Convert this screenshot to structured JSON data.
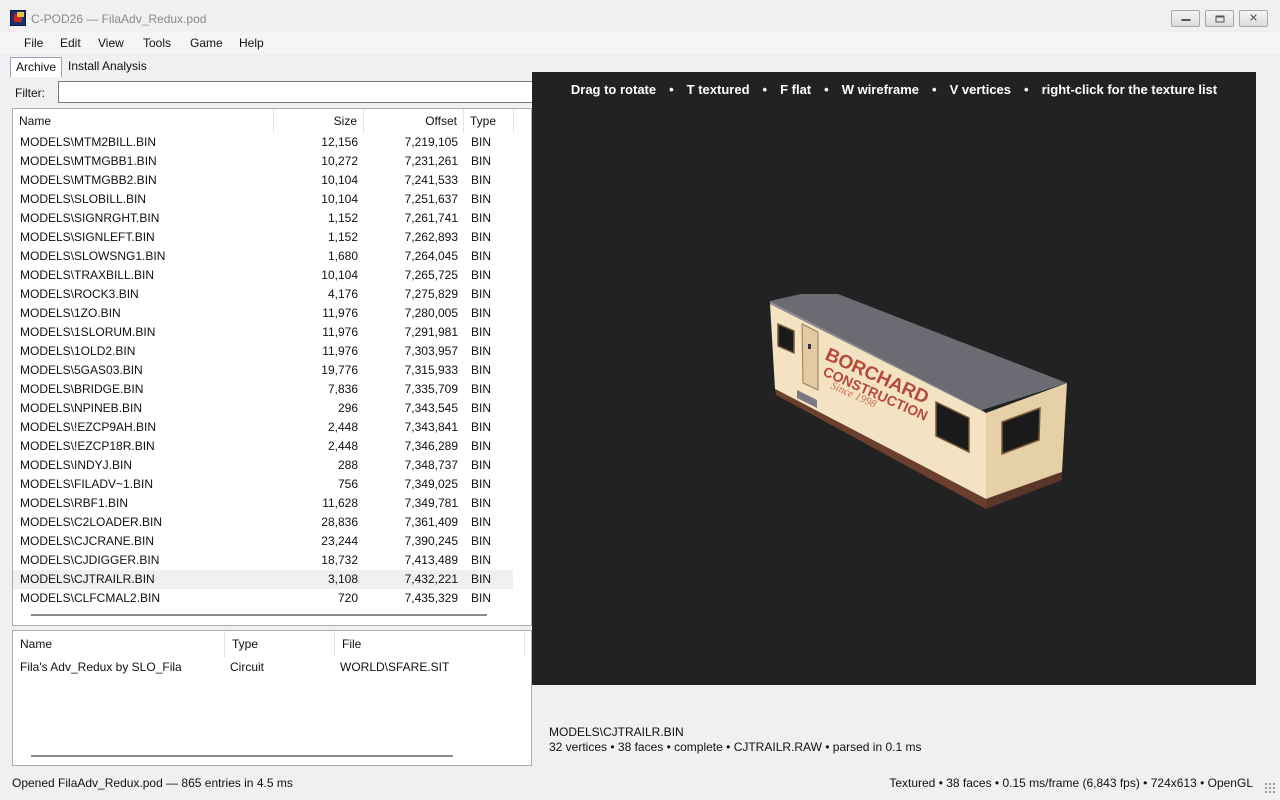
{
  "window": {
    "title": "C-POD26 — FilaAdv_Redux.pod",
    "minimize_glyph": "‒",
    "maximize_glyph": "▫",
    "close_glyph": "✕"
  },
  "menu": [
    "File",
    "Edit",
    "View",
    "Tools",
    "Game",
    "Help"
  ],
  "tabs": [
    {
      "label": "Archive",
      "active": true
    },
    {
      "label": "Install Analysis",
      "active": false
    }
  ],
  "filter": {
    "label": "Filter:",
    "value": ""
  },
  "file_table": {
    "columns": [
      "Name",
      "Size",
      "Offset",
      "Type"
    ],
    "rows": [
      [
        "MODELS\\MTM2BILL.BIN",
        "12,156",
        "7,219,105",
        "BIN"
      ],
      [
        "MODELS\\MTMGBB1.BIN",
        "10,272",
        "7,231,261",
        "BIN"
      ],
      [
        "MODELS\\MTMGBB2.BIN",
        "10,104",
        "7,241,533",
        "BIN"
      ],
      [
        "MODELS\\SLOBILL.BIN",
        "10,104",
        "7,251,637",
        "BIN"
      ],
      [
        "MODELS\\SIGNRGHT.BIN",
        "1,152",
        "7,261,741",
        "BIN"
      ],
      [
        "MODELS\\SIGNLEFT.BIN",
        "1,152",
        "7,262,893",
        "BIN"
      ],
      [
        "MODELS\\SLOWSNG1.BIN",
        "1,680",
        "7,264,045",
        "BIN"
      ],
      [
        "MODELS\\TRAXBILL.BIN",
        "10,104",
        "7,265,725",
        "BIN"
      ],
      [
        "MODELS\\ROCK3.BIN",
        "4,176",
        "7,275,829",
        "BIN"
      ],
      [
        "MODELS\\1ZO.BIN",
        "11,976",
        "7,280,005",
        "BIN"
      ],
      [
        "MODELS\\1SLORUM.BIN",
        "11,976",
        "7,291,981",
        "BIN"
      ],
      [
        "MODELS\\1OLD2.BIN",
        "11,976",
        "7,303,957",
        "BIN"
      ],
      [
        "MODELS\\5GAS03.BIN",
        "19,776",
        "7,315,933",
        "BIN"
      ],
      [
        "MODELS\\BRIDGE.BIN",
        "7,836",
        "7,335,709",
        "BIN"
      ],
      [
        "MODELS\\NPINEB.BIN",
        "296",
        "7,343,545",
        "BIN"
      ],
      [
        "MODELS\\!EZCP9AH.BIN",
        "2,448",
        "7,343,841",
        "BIN"
      ],
      [
        "MODELS\\!EZCP18R.BIN",
        "2,448",
        "7,346,289",
        "BIN"
      ],
      [
        "MODELS\\INDYJ.BIN",
        "288",
        "7,348,737",
        "BIN"
      ],
      [
        "MODELS\\FILADV~1.BIN",
        "756",
        "7,349,025",
        "BIN"
      ],
      [
        "MODELS\\RBF1.BIN",
        "11,628",
        "7,349,781",
        "BIN"
      ],
      [
        "MODELS\\C2LOADER.BIN",
        "28,836",
        "7,361,409",
        "BIN"
      ],
      [
        "MODELS\\CJCRANE.BIN",
        "23,244",
        "7,390,245",
        "BIN"
      ],
      [
        "MODELS\\CJDIGGER.BIN",
        "18,732",
        "7,413,489",
        "BIN"
      ],
      [
        "MODELS\\CJTRAILR.BIN",
        "3,108",
        "7,432,221",
        "BIN"
      ],
      [
        "MODELS\\CLFCMAL2.BIN",
        "720",
        "7,435,329",
        "BIN"
      ]
    ],
    "selected_index": 23
  },
  "install_table": {
    "columns": [
      "Name",
      "Type",
      "File"
    ],
    "rows": [
      [
        "Fila's Adv_Redux by SLO_Fila",
        "Circuit",
        "WORLD\\SFARE.SIT"
      ]
    ]
  },
  "viewport": {
    "hints": [
      "Drag to rotate",
      "T textured",
      "F flat",
      "W wireframe",
      "V vertices",
      "right-click for the texture list"
    ],
    "separator": "•",
    "background": "#222222",
    "model_text": {
      "brand": "BORCHARD",
      "line2": "CONSTRUCTION",
      "line3": "Since 1998"
    }
  },
  "model_info": {
    "name": "MODELS\\CJTRAILR.BIN",
    "details": "32 vertices  •  38 faces  •  complete  •  CJTRAILR.RAW  •  parsed in 0.1 ms"
  },
  "status": {
    "left": "Opened FilaAdv_Redux.pod — 865 entries in 4.5 ms",
    "right": "Textured  •  38 faces  •  0.15 ms/frame (6,843 fps)  •  724x613  •  OpenGL"
  }
}
